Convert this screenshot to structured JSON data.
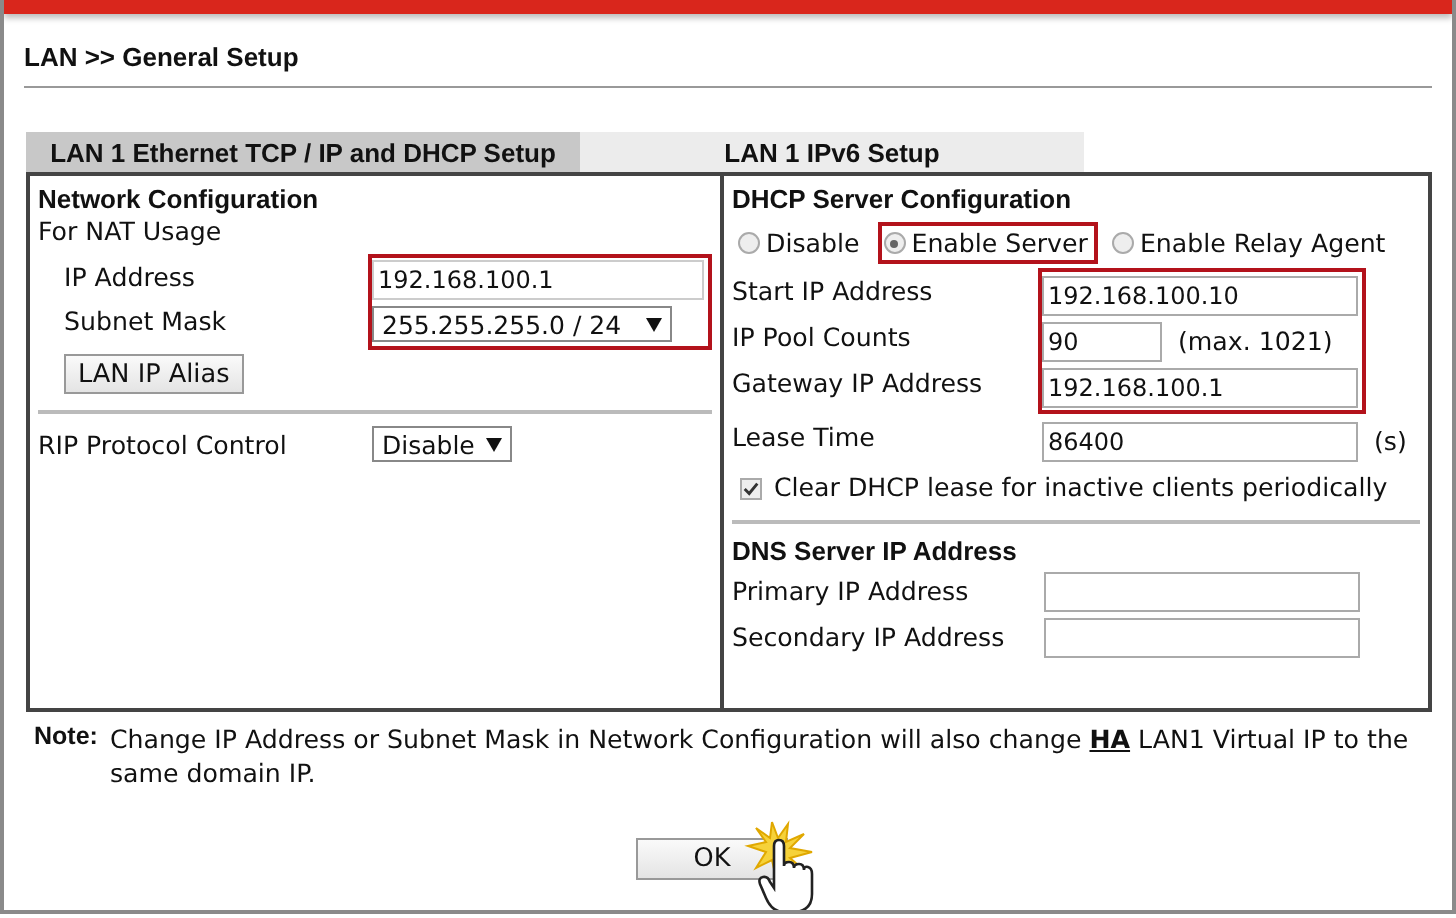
{
  "page_title": "LAN >> General Setup",
  "tabs": [
    {
      "label": "LAN 1 Ethernet TCP / IP and DHCP Setup",
      "selected": true
    },
    {
      "label": "LAN 1 IPv6 Setup",
      "selected": false
    }
  ],
  "network": {
    "heading": "Network Configuration",
    "subheading": "For NAT Usage",
    "groups": [
      {
        "highlighted": true,
        "rows": [
          {
            "label": "IP Address",
            "kind": "input",
            "value": "192.168.100.1"
          },
          {
            "label": "Subnet Mask",
            "kind": "select",
            "value": "255.255.255.0 / 24"
          }
        ]
      }
    ],
    "alias_button": "LAN IP Alias",
    "rip": {
      "label": "RIP Protocol Control",
      "value": "Disable"
    }
  },
  "dhcp": {
    "heading": "DHCP Server Configuration",
    "modes": [
      {
        "label": "Disable",
        "selected": false,
        "highlighted": false
      },
      {
        "label": "Enable Server",
        "selected": true,
        "highlighted": true
      },
      {
        "label": "Enable Relay Agent",
        "selected": false,
        "highlighted": false
      }
    ],
    "groups": [
      {
        "highlighted": true,
        "rows": [
          {
            "label": "Start IP Address",
            "kind": "input",
            "value": "192.168.100.10"
          },
          {
            "label": "IP Pool Counts",
            "kind": "short-input",
            "value": "90",
            "suffix": "(max. 1021)"
          },
          {
            "label": "Gateway IP Address",
            "kind": "input",
            "value": "192.168.100.1"
          }
        ]
      },
      {
        "highlighted": false,
        "rows": [
          {
            "label": "Lease Time",
            "kind": "input",
            "value": "86400",
            "suffix": "(s)"
          }
        ]
      }
    ],
    "clear_lease": {
      "label": "Clear DHCP lease for inactive clients periodically",
      "checked": true
    }
  },
  "dns": {
    "heading": "DNS Server IP Address",
    "rows": [
      {
        "label": "Primary IP Address",
        "value": ""
      },
      {
        "label": "Secondary IP Address",
        "value": ""
      }
    ]
  },
  "note": {
    "label": "Note:",
    "text": "Change IP Address or Subnet Mask in Network Configuration will also change **HA** LAN1 Virtual IP to the same domain IP."
  },
  "ok_button": "OK"
}
